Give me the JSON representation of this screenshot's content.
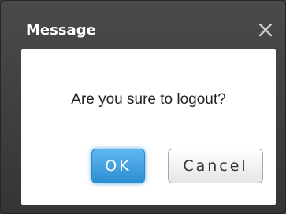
{
  "dialog": {
    "title": "Message",
    "message": "Are you sure to logout?",
    "ok_label": "OK",
    "cancel_label": "Cancel",
    "close_icon": "close-icon"
  },
  "colors": {
    "titlebar": "#3f3f3f",
    "ok_button": "#3a9ae0",
    "body": "#ffffff"
  }
}
